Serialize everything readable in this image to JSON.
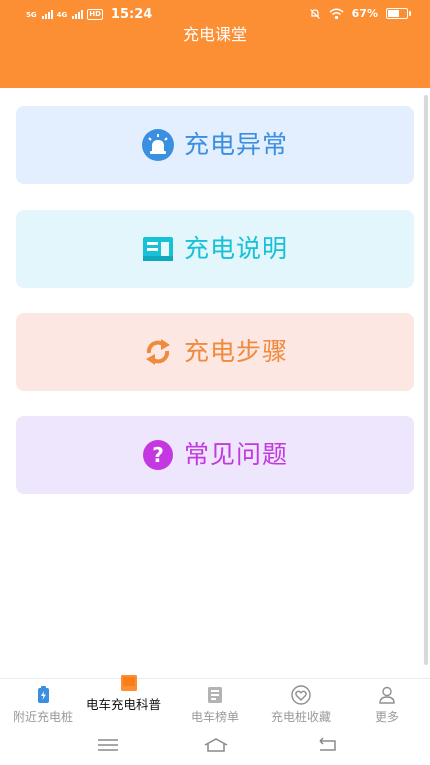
{
  "status_bar": {
    "signal1_label": "5G",
    "signal2_label": "4G",
    "hd_label": "HD",
    "time": "15:24",
    "battery_percent": "67%",
    "battery_level": 0.67
  },
  "header": {
    "title": "充电课堂"
  },
  "menu": {
    "items": [
      {
        "label": "充电异常",
        "icon": "alarm-icon",
        "bg": "#e3efff",
        "color": "#3b8fe0"
      },
      {
        "label": "充电说明",
        "icon": "document-icon",
        "bg": "#e2f6fb",
        "color": "#17c1d8"
      },
      {
        "label": "充电步骤",
        "icon": "refresh-icon",
        "bg": "#fde7e3",
        "color": "#f08a3c"
      },
      {
        "label": "常见问题",
        "icon": "question-icon",
        "bg": "#ede6fd",
        "color": "#c338e0"
      }
    ]
  },
  "tabbar": {
    "tabs": [
      {
        "label": "附近充电桩",
        "icon": "charging-station-icon"
      },
      {
        "label": "电车充电科普",
        "icon": "book-icon"
      },
      {
        "label": "电车榜单",
        "icon": "list-icon"
      },
      {
        "label": "充电桩收藏",
        "icon": "heart-icon"
      },
      {
        "label": "更多",
        "icon": "person-icon"
      }
    ],
    "active_index": 1,
    "active_color": "#fc8e33",
    "inactive_color": "#9a9a9a"
  },
  "theme": {
    "header_color": "#fc8e33"
  }
}
